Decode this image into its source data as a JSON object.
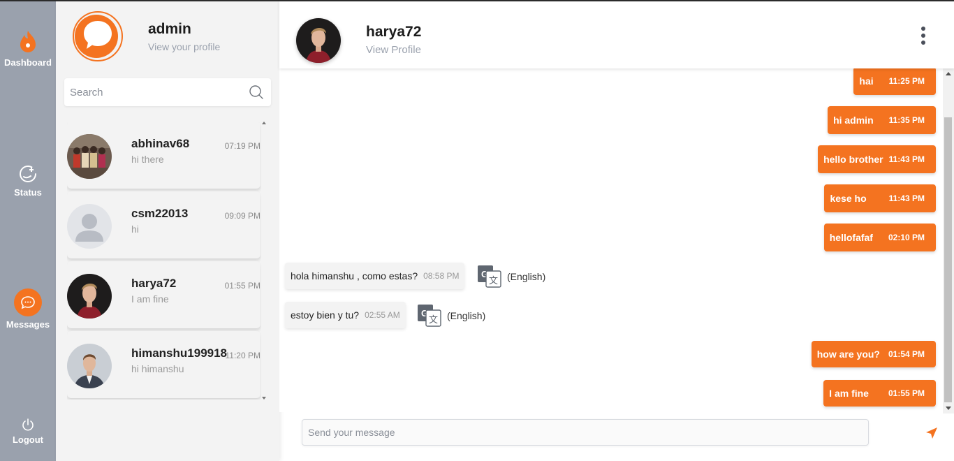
{
  "nav": {
    "dashboard_label": "Dashboard",
    "status_label": "Status",
    "messages_label": "Messages",
    "logout_label": "Logout"
  },
  "profile": {
    "name": "admin",
    "link": "View your profile"
  },
  "search": {
    "placeholder": "Search"
  },
  "contacts": [
    {
      "name": "abhinav68",
      "preview": "hi there",
      "time": "07:19 PM",
      "avatar": "group-photo"
    },
    {
      "name": "csm22013",
      "preview": "hi",
      "time": "09:09 PM",
      "avatar": "default-user"
    },
    {
      "name": "harya72",
      "preview": "I am fine",
      "time": "01:55 PM",
      "avatar": "man-red-shirt"
    },
    {
      "name": "himanshu199918",
      "preview": "hi himanshu",
      "time": "11:20 PM",
      "avatar": "man-suit"
    }
  ],
  "chat": {
    "name": "harya72",
    "link": "View Profile",
    "messages": [
      {
        "dir": "out",
        "text": "hai",
        "time": "11:25 PM"
      },
      {
        "dir": "out",
        "text": "hi admin",
        "time": "11:35 PM"
      },
      {
        "dir": "out",
        "text": "hello brother",
        "time": "11:43 PM"
      },
      {
        "dir": "out",
        "text": "kese ho",
        "time": "11:43 PM"
      },
      {
        "dir": "out",
        "text": "hellofafaf",
        "time": "02:10 PM"
      },
      {
        "dir": "in",
        "text": "hola himanshu , como estas?",
        "time": "08:58 PM",
        "translate": "(English)"
      },
      {
        "dir": "in",
        "text": "estoy bien y tu?",
        "time": "02:55 AM",
        "translate": "(English)"
      },
      {
        "dir": "out",
        "text": "how are you?",
        "time": "01:54 PM"
      },
      {
        "dir": "out",
        "text": "I am fine",
        "time": "01:55 PM"
      }
    ]
  },
  "composer": {
    "placeholder": "Send your message"
  },
  "colors": {
    "accent": "#f47320",
    "rail": "#9aa1ad",
    "panel": "#f3f3f3"
  }
}
